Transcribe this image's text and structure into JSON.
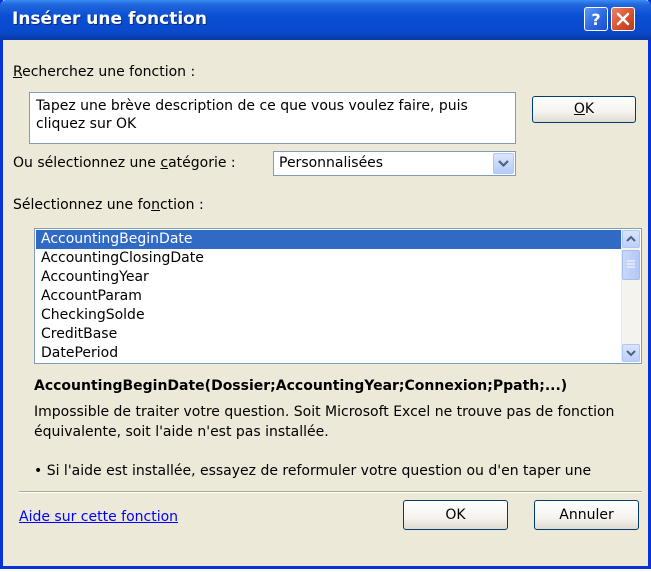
{
  "window": {
    "title": "Insérer une fonction"
  },
  "search": {
    "label_prefix": "",
    "label_key": "R",
    "label_rest": "echerchez une fonction :",
    "value": "Tapez une brève description de ce que vous voulez faire, puis\ncliquez sur OK",
    "go_label_key": "O",
    "go_label_rest": "K"
  },
  "category": {
    "label_prefix": "Ou sélectionnez une ",
    "label_key": "c",
    "label_rest": "atégorie :",
    "selected": "Personnalisées"
  },
  "functions": {
    "label_prefix": "Sélectionnez une fo",
    "label_key": "n",
    "label_rest": "ction :",
    "items": [
      "AccountingBeginDate",
      "AccountingClosingDate",
      "AccountingYear",
      "AccountParam",
      "CheckingSolde",
      "CreditBase",
      "DatePeriod"
    ],
    "selected_index": 0
  },
  "details": {
    "signature": "AccountingBeginDate(Dossier;AccountingYear;Connexion;Ppath;...)",
    "description": "Impossible de traiter votre question. Soit Microsoft Excel ne trouve pas de fonction équivalente, soit l'aide n'est pas installée.",
    "bullet": "• Si l'aide est installée, essayez de reformuler votre question ou d'en taper une"
  },
  "footer": {
    "help_link": "Aide sur cette fonction",
    "ok_label": "OK",
    "cancel_label": "Annuler"
  },
  "colors": {
    "titlebar": "#0a49cc",
    "selection": "#316ac5",
    "link": "#0000ff",
    "dialog_bg": "#ece9d8"
  },
  "icons": {
    "help": "help-icon",
    "close": "close-icon",
    "dropdown": "chevron-down-icon",
    "scroll_up": "arrow-up-icon",
    "scroll_down": "arrow-down-icon"
  }
}
